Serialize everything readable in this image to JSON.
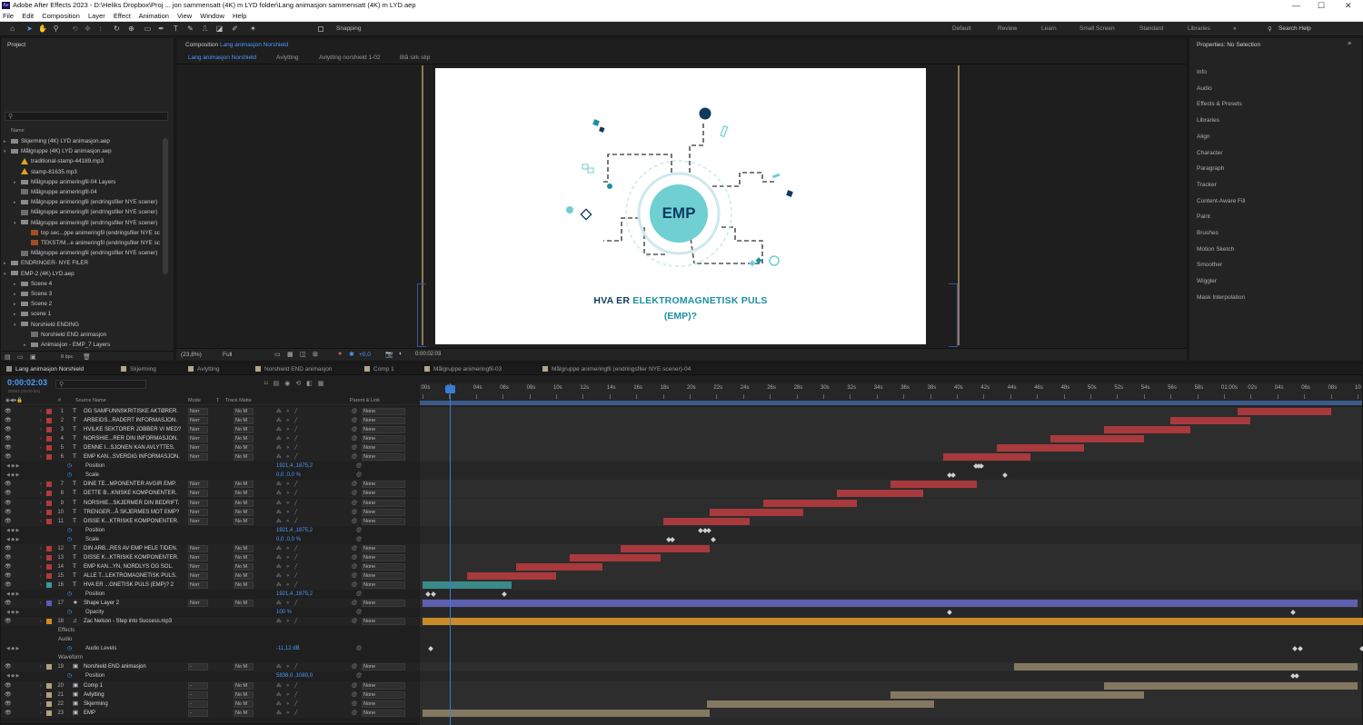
{
  "app": {
    "title": "Adobe After Effects 2023 - D:\\Heliks Dropbox\\Proj ... jon sammensatt (4K) m LYD folder\\Lang animasjon sammensatt (4K) m LYD.aep",
    "logo": "Ae"
  },
  "menu": [
    "File",
    "Edit",
    "Composition",
    "Layer",
    "Effect",
    "Animation",
    "View",
    "Window",
    "Help"
  ],
  "toolbar": {
    "snapping": "Snapping",
    "workspaces": [
      "Default",
      "Review",
      "Learn",
      "Small Screen",
      "Standard",
      "Libraries"
    ],
    "search": "Search Help"
  },
  "project": {
    "title": "Project",
    "col_name": "Name",
    "items": [
      {
        "label": "Skjerming (4K) LYD animasjon.aep",
        "indent": 0,
        "icon": "folder",
        "tri": ">"
      },
      {
        "label": "Målgruppe (4K) LYD animasjon.aep",
        "indent": 0,
        "icon": "folder",
        "tri": "v"
      },
      {
        "label": "traditional-stamp-44189.mp3",
        "indent": 1,
        "icon": "audio",
        "tri": ""
      },
      {
        "label": "stamp-81635.mp3",
        "indent": 1,
        "icon": "audio",
        "tri": ""
      },
      {
        "label": "Målgruppe animeringfil-04 Layers",
        "indent": 1,
        "icon": "folder",
        "tri": ">"
      },
      {
        "label": "Målgruppe animeringfil-04",
        "indent": 1,
        "icon": "comp",
        "tri": ""
      },
      {
        "label": "Målgruppe animeringfil (endringsfiler NYE scener)",
        "indent": 1,
        "icon": "folder",
        "tri": ">"
      },
      {
        "label": "Målgruppe animeringfil (endringsfiler NYE scener)",
        "indent": 1,
        "icon": "comp",
        "tri": ""
      },
      {
        "label": "Målgruppe animeringfil (endringsfiler NYE scener)",
        "indent": 1,
        "icon": "folder",
        "tri": "v"
      },
      {
        "label": "top sec...ppe animeringfil (endringsfiler NYE sc",
        "indent": 2,
        "icon": "psd",
        "tri": ""
      },
      {
        "label": "TEKST/M...e animeringfil (endringsfiler NYE sc",
        "indent": 2,
        "icon": "psd",
        "tri": ""
      },
      {
        "label": "Målgruppe animeringfil (endringsfiler NYE scener)",
        "indent": 1,
        "icon": "comp",
        "tri": ""
      },
      {
        "label": "ENDRINGER- NYE FILER",
        "indent": 0,
        "icon": "folder",
        "tri": ">"
      },
      {
        "label": "EMP-2 (4K) LYD.aep",
        "indent": 0,
        "icon": "folder",
        "tri": "v"
      },
      {
        "label": "Scene 4",
        "indent": 1,
        "icon": "folder",
        "tri": ">"
      },
      {
        "label": "Scene 3",
        "indent": 1,
        "icon": "folder",
        "tri": ">"
      },
      {
        "label": "Scene 2",
        "indent": 1,
        "icon": "folder",
        "tri": ">"
      },
      {
        "label": "scene 1",
        "indent": 1,
        "icon": "folder",
        "tri": ">"
      },
      {
        "label": "Norshield ENDING",
        "indent": 1,
        "icon": "folder",
        "tri": "v"
      },
      {
        "label": "Norshield END animasjon",
        "indent": 2,
        "icon": "comp",
        "tri": ""
      },
      {
        "label": "Animasjon - EMP_7 Layers",
        "indent": 2,
        "icon": "folder",
        "tri": ">"
      }
    ],
    "bpc": "8 bpc"
  },
  "composition": {
    "header": "Composition",
    "name": "Lang animasjon Norshield",
    "breadcrumbs": [
      "Lang animasjon Norshield",
      "Avlytting",
      "Avlytting norshield 1-02",
      "Blå sirk stip"
    ],
    "zoom": "(23,8%)",
    "quality": "Full",
    "exposure": "+0,0",
    "time": "0:00:02:03"
  },
  "artwork": {
    "emp": "EMP",
    "headline_1": "HVA ER",
    "headline_2": "ELEKTROMAGNETISK PULS",
    "headline_3": "(EMP)?",
    "navy": "#0f3b5f",
    "teal": "#1d8fa3",
    "cyan": "#6fcfd2"
  },
  "properties": {
    "title": "Properties: No Selection",
    "items": [
      "Info",
      "Audio",
      "Effects & Presets",
      "Libraries",
      "Align",
      "Character",
      "Paragraph",
      "Tracker",
      "Content-Aware Fill",
      "Paint",
      "Brushes",
      "Motion Sketch",
      "Smoother",
      "Wiggler",
      "Mask Interpolation"
    ]
  },
  "timeline": {
    "tabs": [
      {
        "label": "Lang animasjon Norshield",
        "color": "#8f8f8f"
      },
      {
        "label": "Skjerming",
        "color": "#b5a58a"
      },
      {
        "label": "Avlytting",
        "color": "#b5a58a"
      },
      {
        "label": "Norshield END animasjon",
        "color": "#b5a58a"
      },
      {
        "label": "Comp 1",
        "color": "#b5a58a"
      },
      {
        "label": "Målgruppe animeringfil-03",
        "color": "#b5a58a"
      },
      {
        "label": "Målgruppe animeringfil (endringsfiler NYE scener)-04",
        "color": "#b5a58a"
      }
    ],
    "timecode": "0:00:02:03",
    "fps": "00063 (30.00 fps)",
    "col_headers": {
      "num": "#",
      "source": "Source Name",
      "mode": "Mode",
      "t": "T",
      "matte": "Track Matte",
      "parent": "Parent & Link"
    },
    "ruler": [
      ":00s",
      "02s",
      "04s",
      "06s",
      "08s",
      "10s",
      "12s",
      "14s",
      "16s",
      "18s",
      "20s",
      "22s",
      "24s",
      "26s",
      "28s",
      "30s",
      "32s",
      "34s",
      "36s",
      "38s",
      "40s",
      "42s",
      "44s",
      "46s",
      "48s",
      "50s",
      "52s",
      "54s",
      "56s",
      "58s",
      "01:00s",
      "02s",
      "04s",
      "06s",
      "08s",
      "10"
    ],
    "rows": [
      {
        "type": "layer",
        "num": "1",
        "icon": "T",
        "name": "OG SAMFUNNSKRITISKE AKTØRER.",
        "mode": "Norr",
        "matte": "No M",
        "parent": "None",
        "label": "#b23a3a",
        "bar": [
          61,
          68
        ],
        "barcolor": "#a8393c"
      },
      {
        "type": "layer",
        "num": "2",
        "icon": "T",
        "name": "ARBEIDS...RADERT INFORMASJON.",
        "mode": "Norr",
        "matte": "No M",
        "parent": "None",
        "label": "#b23a3a",
        "bar": [
          56,
          62
        ],
        "barcolor": "#a8393c"
      },
      {
        "type": "layer",
        "num": "3",
        "icon": "T",
        "name": "HVILKE SEKTORER JOBBER VI MED?",
        "mode": "Norr",
        "matte": "No M",
        "parent": "None",
        "label": "#b23a3a",
        "bar": [
          51,
          57.5
        ],
        "barcolor": "#a8393c"
      },
      {
        "type": "layer",
        "num": "4",
        "icon": "T",
        "name": "NORSHIE...RER DIN INFORMASJON.",
        "mode": "Norr",
        "matte": "No M",
        "parent": "None",
        "label": "#b23a3a",
        "bar": [
          47,
          54
        ],
        "barcolor": "#a8393c"
      },
      {
        "type": "layer",
        "num": "5",
        "icon": "T",
        "name": "DENNE I...SJONEN KAN AVLYTTES.",
        "mode": "Norr",
        "matte": "No M",
        "parent": "None",
        "label": "#b23a3a",
        "bar": [
          43,
          49.5
        ],
        "barcolor": "#a8393c"
      },
      {
        "type": "layer",
        "num": "6",
        "icon": "T",
        "name": "EMP KAN...SVERDIG INFORMASJON.",
        "mode": "Norr",
        "matte": "No M",
        "parent": "None",
        "label": "#b23a3a",
        "bar": [
          39,
          45.5
        ],
        "barcolor": "#a8393c"
      },
      {
        "type": "prop",
        "name": "Position",
        "value": "1921,4 ,1875,2",
        "kfs": [
          41.3,
          41.5,
          41.7
        ]
      },
      {
        "type": "prop",
        "name": "Scale",
        "value": "0,0 ,0,0 %",
        "kfs": [
          39.3,
          39.6,
          43.5
        ]
      },
      {
        "type": "layer",
        "num": "7",
        "icon": "T",
        "name": "DINE TE...MPONENTER AVGIR EMP.",
        "mode": "Norr",
        "matte": "No M",
        "parent": "None",
        "label": "#b23a3a",
        "bar": [
          35,
          41.5
        ],
        "barcolor": "#a8393c"
      },
      {
        "type": "layer",
        "num": "8",
        "icon": "T",
        "name": "DETTE B...KNISKE KOMPONENTER.",
        "mode": "Norr",
        "matte": "No M",
        "parent": "None",
        "label": "#b23a3a",
        "bar": [
          31,
          37.5
        ],
        "barcolor": "#a8393c"
      },
      {
        "type": "layer",
        "num": "9",
        "icon": "T",
        "name": "NORSHIE...SKJERMER DIN BEDRIFT.",
        "mode": "Norr",
        "matte": "No M",
        "parent": "None",
        "label": "#b23a3a",
        "bar": [
          25.5,
          32.5
        ],
        "barcolor": "#a8393c"
      },
      {
        "type": "layer",
        "num": "10",
        "icon": "T",
        "name": "TRENGER...Å SKJERMES MOT EMP?",
        "mode": "Norr",
        "matte": "No M",
        "parent": "None",
        "label": "#b23a3a",
        "bar": [
          21.5,
          28.5
        ],
        "barcolor": "#a8393c"
      },
      {
        "type": "layer",
        "num": "11",
        "icon": "T",
        "name": "DISSE K...KTRISKE KOMPONENTER.",
        "mode": "Norr",
        "matte": "No M",
        "parent": "None",
        "label": "#b23a3a",
        "bar": [
          18,
          24.5
        ],
        "barcolor": "#a8393c"
      },
      {
        "type": "prop",
        "name": "Position",
        "value": "1921,4 ,1875,2",
        "kfs": [
          20.7,
          21,
          21.3
        ]
      },
      {
        "type": "prop",
        "name": "Scale",
        "value": "0,0 ,0,0 %",
        "kfs": [
          18.3,
          18.6,
          21.6
        ]
      },
      {
        "type": "layer",
        "num": "12",
        "icon": "T",
        "name": "DIN ARB...RES AV EMP HELE TIDEN.",
        "mode": "Norr",
        "matte": "No M",
        "parent": "None",
        "label": "#b23a3a",
        "bar": [
          14.8,
          21.5
        ],
        "barcolor": "#a8393c"
      },
      {
        "type": "layer",
        "num": "13",
        "icon": "T",
        "name": "DISSE K...KTRISKE KOMPONENTER.",
        "mode": "Norr",
        "matte": "No M",
        "parent": "None",
        "label": "#b23a3a",
        "bar": [
          11,
          17.8
        ],
        "barcolor": "#a8393c"
      },
      {
        "type": "layer",
        "num": "14",
        "icon": "T",
        "name": "EMP KAN...YN, NORDLYS OG SOL.",
        "mode": "Norr",
        "matte": "No M",
        "parent": "None",
        "label": "#b23a3a",
        "bar": [
          7,
          13.5
        ],
        "barcolor": "#a8393c"
      },
      {
        "type": "layer",
        "num": "15",
        "icon": "T",
        "name": "ALLE T...LEKTROMAGNETISK PULS.",
        "mode": "Norr",
        "matte": "No M",
        "parent": "None",
        "label": "#b23a3a",
        "bar": [
          3.3,
          10
        ],
        "barcolor": "#a8393c"
      },
      {
        "type": "layer",
        "num": "16",
        "icon": "T",
        "name": "HVA ER ...GNETISK PULS (EMP)? 2",
        "mode": "Norr",
        "matte": "No M",
        "parent": "None",
        "label": "#3a9a9a",
        "bar": [
          0,
          6.7
        ],
        "barcolor": "#3a8a8a"
      },
      {
        "type": "prop",
        "name": "Position",
        "value": "1921,4 ,1875,2",
        "kfs": [
          0.3,
          0.7,
          6
        ]
      },
      {
        "type": "layer",
        "num": "17",
        "icon": "★",
        "name": "Shape Layer 2",
        "mode": "Norr",
        "matte": "No M",
        "parent": "None",
        "label": "#5a5ac0",
        "bar": [
          0,
          70
        ],
        "barcolor": "#5d5fb0"
      },
      {
        "type": "prop",
        "name": "Opacity",
        "value": "100 %",
        "kfs": [
          39.3,
          65
        ]
      },
      {
        "type": "layer",
        "num": "18",
        "icon": "♫",
        "name": "Zac Nelson - Step into Success.mp3",
        "mode": "",
        "matte": "",
        "parent": "None",
        "label": "#d08a20",
        "bar": [
          0,
          71
        ],
        "barcolor": "#c98a2c"
      },
      {
        "type": "sub",
        "name": "Effects"
      },
      {
        "type": "sub",
        "name": "Audio"
      },
      {
        "type": "prop",
        "name": "Audio Levels",
        "value": "-11,12 dB",
        "kfs": [
          0.5,
          65.2,
          65.6,
          70.2
        ]
      },
      {
        "type": "sub",
        "name": "Waveform"
      },
      {
        "type": "layer",
        "num": "19",
        "icon": "▣",
        "name": "Norshield END animasjon",
        "mode": "-",
        "matte": "No M",
        "parent": "None",
        "label": "#b0a080",
        "bar": [
          44.3,
          70
        ],
        "barcolor": "#857862"
      },
      {
        "type": "prop",
        "name": "Position",
        "value": "5836,0 ,1080,0",
        "kfs": [
          65,
          65.3
        ]
      },
      {
        "type": "layer",
        "num": "20",
        "icon": "▣",
        "name": "Comp 1",
        "mode": "-",
        "matte": "No M",
        "parent": "None",
        "label": "#b0a080",
        "bar": [
          51,
          70
        ],
        "barcolor": "#857862"
      },
      {
        "type": "layer",
        "num": "21",
        "icon": "▣",
        "name": "Avlytting",
        "mode": "-",
        "matte": "No M",
        "parent": "None",
        "label": "#b0a080",
        "bar": [
          35,
          54
        ],
        "barcolor": "#857862"
      },
      {
        "type": "layer",
        "num": "22",
        "icon": "▣",
        "name": "Skjerming",
        "mode": "-",
        "matte": "No M",
        "parent": "None",
        "label": "#b0a080",
        "bar": [
          21.3,
          38.3
        ],
        "barcolor": "#857862"
      },
      {
        "type": "layer",
        "num": "23",
        "icon": "▣",
        "name": "EMP",
        "mode": "-",
        "matte": "No M",
        "parent": "None",
        "label": "#b0a080",
        "bar": [
          0,
          21.5
        ],
        "barcolor": "#857862"
      }
    ]
  }
}
